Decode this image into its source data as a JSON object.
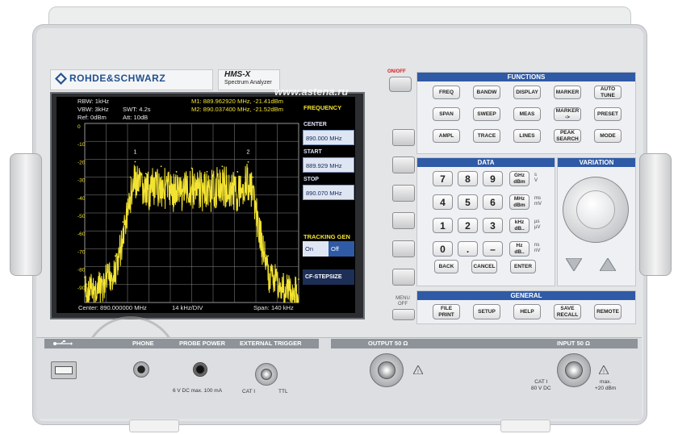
{
  "brand": {
    "name": "ROHDE&SCHWARZ",
    "model": "HMS-X",
    "subtitle": "Spectrum Analyzer"
  },
  "watermark": {
    "url": "www.astena.ru"
  },
  "power": {
    "label": "ON/OFF"
  },
  "screen": {
    "rbw": "RBW: 1kHz",
    "vbw": "VBW: 3kHz",
    "swt": "SWT: 4.2s",
    "ref": "Ref: 0dBm",
    "att": "Att: 10dB",
    "m1": "M1: 889.962920 MHz, -21.41dBm",
    "m2": "M2: 890.037400 MHz, -21.52dBm",
    "center_readout": "Center: 890.000000 MHz",
    "div_readout": "14 kHz/DIV",
    "span_readout": "Span: 140 kHz",
    "marker1": "1",
    "marker2": "2"
  },
  "chart_data": {
    "type": "line",
    "title": "",
    "xlabel": "",
    "ylabel": "",
    "x_range_mhz": [
      889.93,
      890.07
    ],
    "ylim": [
      -100,
      0
    ],
    "y_ticks": [
      "0",
      "-10",
      "-20",
      "-30",
      "-40",
      "-50",
      "-60",
      "-70",
      "-80",
      "-90"
    ],
    "grid": true,
    "series": [
      {
        "x": [
          889.93,
          889.94,
          889.95,
          889.955,
          889.96,
          889.963,
          889.97,
          889.98,
          889.99,
          890.0,
          890.01,
          890.02,
          890.03,
          890.037,
          890.04,
          890.045,
          890.05,
          890.06,
          890.07
        ],
        "y": [
          -86,
          -84,
          -74,
          -55,
          -30,
          -21.4,
          -28,
          -24,
          -27,
          -25,
          -27,
          -24,
          -27,
          -21.5,
          -30,
          -55,
          -74,
          -84,
          -87
        ]
      }
    ]
  },
  "menu": {
    "frequency_title": "FREQUENCY",
    "center_label": "CENTER",
    "center_value": "890.000 MHz",
    "start_label": "START",
    "start_value": "889.929 MHz",
    "stop_label": "STOP",
    "stop_value": "890.070 MHz",
    "tracking_title": "TRACKING GEN",
    "tracking_on": "On",
    "tracking_off": "Off",
    "cf_stepsize": "CF-STEPSIZE"
  },
  "menu_off": "MENU OFF",
  "functions": {
    "title": "FUNCTIONS",
    "keys": [
      "FREQ",
      "BANDW",
      "DISPLAY",
      "MARKER",
      "AUTO\nTUNE",
      "SPAN",
      "SWEEP",
      "MEAS",
      "MARKER\n->",
      "PRESET",
      "AMPL",
      "TRACE",
      "LINES",
      "PEAK\nSEARCH",
      "MODE"
    ]
  },
  "data_panel": {
    "title": "DATA",
    "digits": [
      "7",
      "8",
      "9",
      "4",
      "5",
      "6",
      "1",
      "2",
      "3",
      "0",
      ".",
      "–"
    ],
    "unit_keys": [
      "GHz\ndBm",
      "MHz\ndBm",
      "kHz\ndB..",
      "Hz\ndB.."
    ],
    "unit_sides": [
      "s\nV",
      "ms\nmV",
      "µs\nµV",
      "ns\nnV"
    ],
    "back": "BACK",
    "cancel": "CANCEL",
    "enter": "ENTER"
  },
  "variation": {
    "title": "VARIATION"
  },
  "general": {
    "title": "GENERAL",
    "keys": [
      "FILE\nPRINT",
      "SETUP",
      "HELP",
      "SAVE\nRECALL",
      "REMOTE"
    ]
  },
  "connectors": {
    "usb_icon": "usb-icon",
    "phone": "PHONE",
    "probe_power": "PROBE POWER",
    "probe_spec": "6 V DC  max. 100 mA",
    "external_trigger": "EXTERNAL TRIGGER",
    "cat": "CAT I",
    "ttl": "TTL",
    "output": "OUTPUT 50 Ω",
    "input": "INPUT 50 Ω",
    "input_cat": "CAT I\n80 V DC",
    "input_max": "max.\n+20 dBm"
  },
  "colors": {
    "accent": "#2f5aa6",
    "trace": "#f3e332",
    "screen_bg": "#000000"
  }
}
